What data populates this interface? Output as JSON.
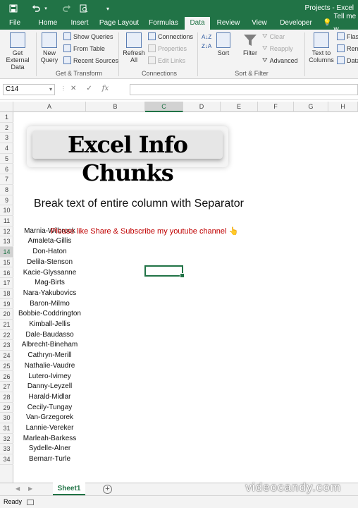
{
  "window": {
    "title": "Projects - Excel"
  },
  "tabs": [
    "File",
    "Home",
    "Insert",
    "Page Layout",
    "Formulas",
    "Data",
    "Review",
    "View",
    "Developer"
  ],
  "active_tab": "Data",
  "tell_me": "Tell me w",
  "ribbon": {
    "get_external_data": "Get External Data",
    "new_query": "New Query",
    "show_queries": "Show Queries",
    "from_table": "From Table",
    "recent_sources": "Recent Sources",
    "group_get_transform": "Get & Transform",
    "refresh_all": "Refresh All",
    "connections": "Connections",
    "properties": "Properties",
    "edit_links": "Edit Links",
    "group_connections": "Connections",
    "sort": "Sort",
    "filter": "Filter",
    "clear": "Clear",
    "reapply": "Reapply",
    "advanced": "Advanced",
    "group_sort_filter": "Sort & Filter",
    "text_to_columns": "Text to Columns",
    "flash": "Flas",
    "remove": "Rem",
    "data_val": "Data"
  },
  "formula_bar": {
    "name_box": "C14",
    "fx": "fx",
    "formula": ""
  },
  "columns": [
    "A",
    "B",
    "C",
    "D",
    "E",
    "F",
    "G",
    "H"
  ],
  "selected_column": "C",
  "rows": [
    "1",
    "2",
    "3",
    "4",
    "5",
    "6",
    "7",
    "8",
    "9",
    "10",
    "11",
    "12",
    "13",
    "14",
    "15",
    "16",
    "17",
    "18",
    "19",
    "20",
    "21",
    "22",
    "23",
    "24",
    "25",
    "26",
    "27",
    "28",
    "29",
    "30",
    "31",
    "32",
    "33",
    "34"
  ],
  "selected_row": "14",
  "logo_text": "Excel Info Chunks",
  "heading": "Break text of entire column with Separator",
  "promo": "Please like Share & Subscribe my youtube channel 👆",
  "names": [
    "Marnia-Wilbrook",
    "Amaleta-Gillis",
    "Don-Haton",
    "Delila-Stenson",
    "Kacie-Glyssanne",
    "Mag-Birts",
    "Nara-Yakubovics",
    "Baron-Milmo",
    "Bobbie-Coddrington",
    "Kimball-Jellis",
    "Dale-Baudasso",
    "Albrecht-Bineham",
    "Cathryn-Merill",
    "Nathalie-Vaudre",
    "Lutero-Ivimey",
    "Danny-Leyzell",
    "Harald-Midlar",
    "Cecily-Tungay",
    "Van-Grzegorek",
    "Lannie-Vereker",
    "Marleah-Barkess",
    "Sydelle-Alner",
    "Bernarr-Turle"
  ],
  "sheet_tab": "Sheet1",
  "status": "Ready",
  "watermark": "videocandy.com"
}
